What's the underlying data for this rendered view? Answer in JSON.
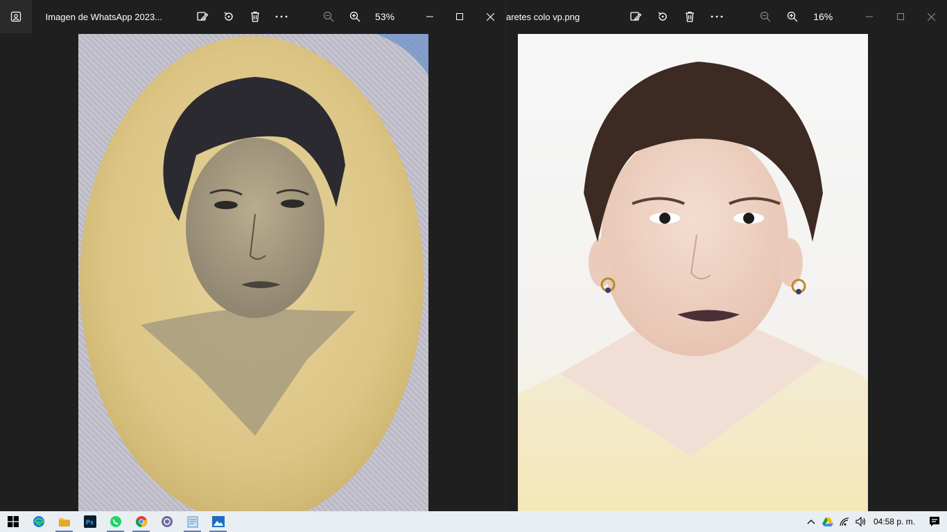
{
  "windows": {
    "left": {
      "title": "Imagen de WhatsApp 2023...",
      "zoom": "53%",
      "buttons": {
        "edit": "edit-image",
        "rotate": "rotate",
        "delete": "delete",
        "more": "more-options",
        "zoom_out": "zoom-out",
        "zoom_in": "zoom-in"
      }
    },
    "right": {
      "title": "aretes colo vp.png",
      "zoom": "16%"
    }
  },
  "taskbar": {
    "apps": [
      "windows-start",
      "edge",
      "file-explorer",
      "photoshop",
      "whatsapp",
      "chrome",
      "app-orbit",
      "notepad",
      "photos"
    ],
    "clock": "04:58 p. m."
  },
  "colors": {
    "window_bg": "#1f1f1f",
    "taskbar_bg": "#e9eef2",
    "photo_card": "#d9c48a"
  }
}
